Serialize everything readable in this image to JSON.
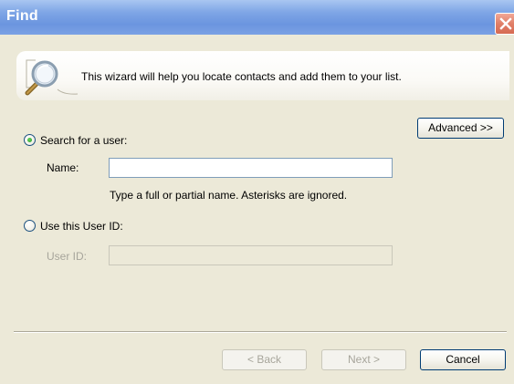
{
  "window": {
    "title": "Find"
  },
  "info": {
    "text": "This wizard will help you locate contacts and add them to your list."
  },
  "advanced_button": "Advanced >>",
  "search_user": {
    "radio_label": "Search for a user:",
    "selected": true,
    "name_label": "Name:",
    "name_value": "",
    "hint": "Type a full or partial name.  Asterisks are ignored."
  },
  "user_id": {
    "radio_label": "Use this User ID:",
    "selected": false,
    "field_label": "User ID:",
    "field_value": ""
  },
  "footer": {
    "back": "< Back",
    "next": "Next >",
    "cancel": "Cancel"
  },
  "icons": {
    "title_close": "close-icon",
    "info": "magnifier-icon"
  },
  "colors": {
    "titlebar": "#7fa6e6",
    "close": "#e07f68",
    "dialog_bg": "#ece9d8",
    "radio_dot": "#2d9a2a"
  }
}
